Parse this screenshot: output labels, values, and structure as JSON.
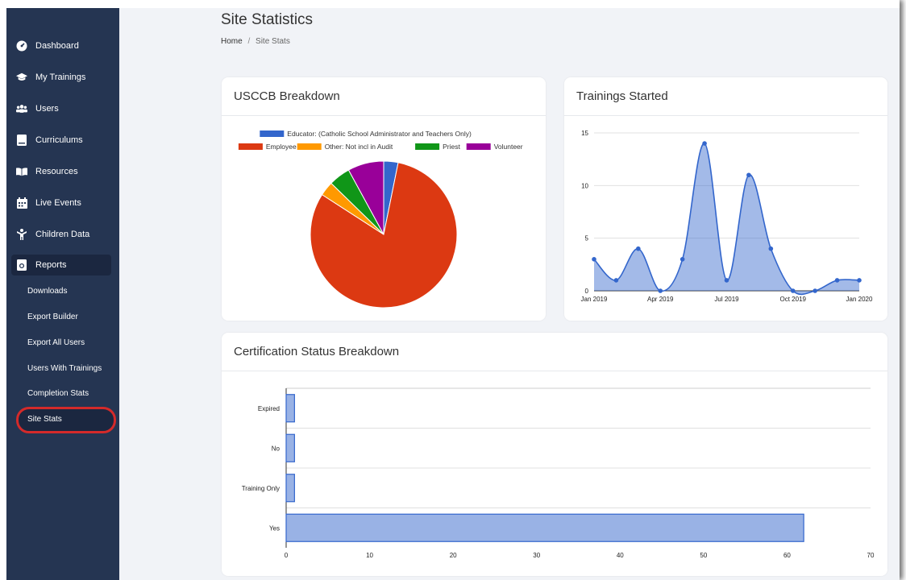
{
  "sidebar": {
    "items": [
      {
        "label": "Dashboard",
        "icon": "gauge-icon"
      },
      {
        "label": "My Trainings",
        "icon": "graduation-cap-icon"
      },
      {
        "label": "Users",
        "icon": "users-icon"
      },
      {
        "label": "Curriculums",
        "icon": "book-icon"
      },
      {
        "label": "Resources",
        "icon": "open-book-icon"
      },
      {
        "label": "Live Events",
        "icon": "calendar-icon"
      },
      {
        "label": "Children Data",
        "icon": "child-icon"
      },
      {
        "label": "Reports",
        "icon": "report-icon"
      }
    ],
    "report_subitems": [
      "Downloads",
      "Export Builder",
      "Export All Users",
      "Users With Trainings",
      "Completion Stats",
      "Site Stats"
    ]
  },
  "page": {
    "title": "Site Statistics",
    "breadcrumb_home": "Home",
    "breadcrumb_sep": "/",
    "breadcrumb_current": "Site Stats"
  },
  "cards": {
    "usccb": "USCCB Breakdown",
    "trainings": "Trainings Started",
    "cert": "Certification Status Breakdown"
  },
  "chart_data": [
    {
      "type": "pie",
      "title": "USCCB Breakdown",
      "legend": [
        "Educator: (Catholic School Administrator and Teachers Only)",
        "Employee",
        "Other: Not incl in Audit",
        "Priest",
        "Volunteer"
      ],
      "values": [
        2,
        51,
        2,
        3,
        5
      ],
      "colors": [
        "#3366cc",
        "#dc3912",
        "#ff9900",
        "#109618",
        "#990099"
      ],
      "legend_position": "top"
    },
    {
      "type": "area",
      "title": "Trainings Started",
      "x": [
        "2019-01",
        "2019-02",
        "2019-03",
        "2019-04",
        "2019-05",
        "2019-06",
        "2019-07",
        "2019-08",
        "2019-09",
        "2019-10",
        "2019-11",
        "2019-12",
        "2020-01"
      ],
      "values": [
        3,
        1,
        4,
        0,
        3,
        14,
        1,
        11,
        4,
        0,
        0,
        1,
        1
      ],
      "x_tick_labels": [
        "Jan 2019",
        "Apr 2019",
        "Jul 2019",
        "Oct 2019",
        "Jan 2020"
      ],
      "y_ticks": [
        0,
        5,
        10,
        15
      ],
      "ylim": [
        0,
        15
      ],
      "color": "#3366cc",
      "grid": true
    },
    {
      "type": "bar",
      "orientation": "horizontal",
      "title": "Certification Status Breakdown",
      "categories": [
        "Expired",
        "No",
        "Training Only",
        "Yes"
      ],
      "values": [
        1,
        1,
        1,
        62
      ],
      "x_ticks": [
        0,
        10,
        20,
        30,
        40,
        50,
        60,
        70
      ],
      "xlim": [
        0,
        70
      ],
      "color": "#3366cc",
      "grid": true
    }
  ]
}
